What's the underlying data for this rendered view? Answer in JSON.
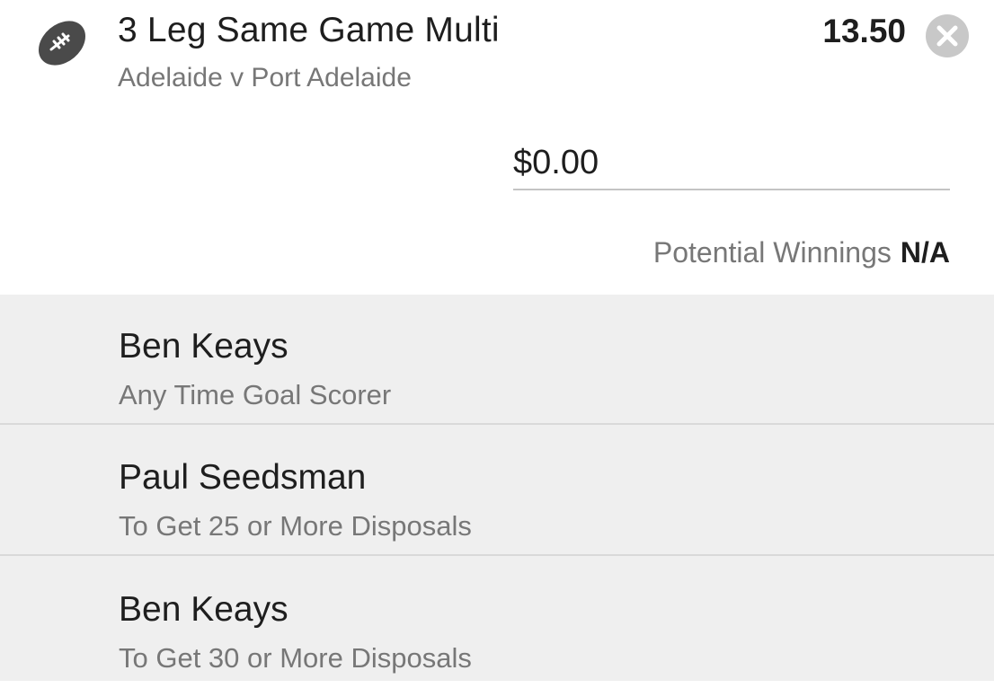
{
  "bet": {
    "sport_icon": "football-icon",
    "title": "3 Leg Same Game Multi",
    "event": "Adelaide v Port Adelaide",
    "odds": "13.50",
    "close_icon": "close-icon"
  },
  "stake": {
    "value": "$0.00"
  },
  "winnings": {
    "label": "Potential Winnings",
    "value": "N/A"
  },
  "legs": [
    {
      "player": "Ben Keays",
      "market": "Any Time Goal Scorer"
    },
    {
      "player": "Paul Seedsman",
      "market": "To Get 25 or More Disposals"
    },
    {
      "player": "Ben Keays",
      "market": "To Get 30 or More Disposals"
    }
  ],
  "colors": {
    "icon": "#4a4a4a",
    "close_button": "#c8c8c8",
    "legs_background": "#efefef",
    "secondary_text": "#777777"
  }
}
